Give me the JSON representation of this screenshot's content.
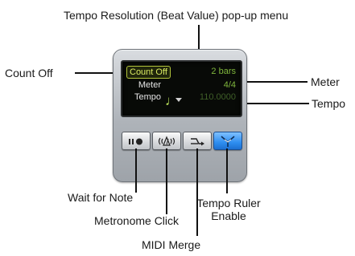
{
  "callouts": {
    "tempo_resolution": "Tempo Resolution (Beat Value) pop-up menu",
    "count_off": "Count Off",
    "meter": "Meter",
    "tempo": "Tempo",
    "wait_for_note": "Wait for Note",
    "metronome_click": "Metronome Click",
    "midi_merge": "MIDI Merge",
    "tempo_ruler_line1": "Tempo Ruler",
    "tempo_ruler_line2": "Enable"
  },
  "display": {
    "count_off_label": "Count Off",
    "count_off_value": "2 bars",
    "meter_label": "Meter",
    "meter_value": "4/4",
    "tempo_label": "Tempo",
    "tempo_value": "110.0000",
    "beat_value_icon": "quarter-note-icon"
  },
  "buttons": [
    {
      "name": "wait-for-note",
      "icon": "pause-record-icon",
      "active": false
    },
    {
      "name": "metronome-click",
      "icon": "metronome-icon",
      "active": false
    },
    {
      "name": "midi-merge",
      "icon": "merge-arrow-icon",
      "active": false
    },
    {
      "name": "tempo-ruler-enable",
      "icon": "conductor-icon",
      "active": true
    }
  ],
  "colors": {
    "lcd_background": "#080a07",
    "lcd_value": "#7fb63c",
    "count_off_highlight": "#d9ea62",
    "active_button": "#2e8ef0"
  }
}
